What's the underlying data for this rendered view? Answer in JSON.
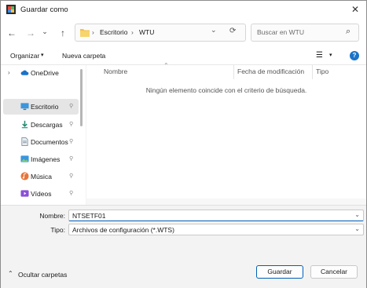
{
  "window": {
    "title": "Guardar como",
    "close_glyph": "✕"
  },
  "nav": {
    "back_glyph": "←",
    "forward_glyph": "→",
    "recent_glyph": "⌄",
    "up_glyph": "↑",
    "breadcrumb": [
      "Escritorio",
      "WTU"
    ],
    "breadcrumb_sep": "›",
    "dropdown_glyph": "⌄",
    "refresh_glyph": "⟳",
    "search_placeholder": "Buscar en WTU",
    "search_glyph": "⌕"
  },
  "toolbar": {
    "organize_label": "Organizar",
    "organize_arrow": "▾",
    "new_folder_label": "Nueva carpeta",
    "view_glyph": "☰",
    "view_arrow": "▾",
    "help_glyph": "?"
  },
  "sidebar": {
    "items": [
      {
        "label": "OneDrive",
        "icon": "cloud-icon",
        "expand": "›"
      },
      {
        "label": "Escritorio",
        "icon": "desktop-icon",
        "pinned": true,
        "selected": true
      },
      {
        "label": "Descargas",
        "icon": "download-icon",
        "pinned": true
      },
      {
        "label": "Documentos",
        "icon": "document-icon",
        "pinned": true
      },
      {
        "label": "Imágenes",
        "icon": "picture-icon",
        "pinned": true
      },
      {
        "label": "Música",
        "icon": "music-icon",
        "pinned": true
      },
      {
        "label": "Vídeos",
        "icon": "video-icon",
        "pinned": true
      }
    ],
    "pin_glyph": "📌"
  },
  "columns": {
    "name": "Nombre",
    "modified": "Fecha de modificación",
    "type": "Tipo",
    "sort_glyph": "⌃"
  },
  "empty_message": "Ningún elemento coincide con el criterio de búsqueda.",
  "form": {
    "name_label": "Nombre:",
    "name_value": "NTSETF01",
    "type_label": "Tipo:",
    "type_value": "Archivos de configuración (*.WTS)",
    "chevron": "⌄"
  },
  "footer": {
    "hide_folders_label": "Ocultar carpetas",
    "hide_folders_glyph": "⌃",
    "save_label": "Guardar",
    "cancel_label": "Cancelar"
  },
  "colors": {
    "accent": "#005fb8",
    "folder": "#f2c14e"
  }
}
